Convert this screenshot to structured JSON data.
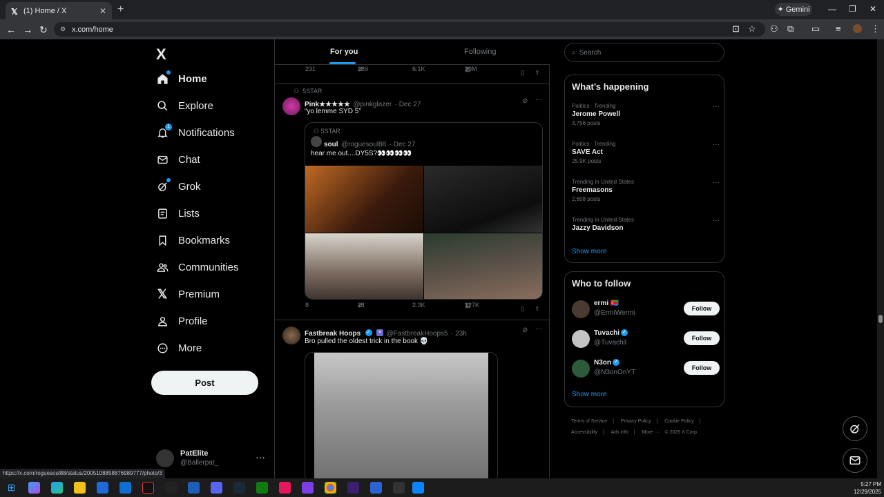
{
  "browser": {
    "tab_title": "(1) Home / X",
    "new_tab": "+",
    "gemini_label": "Gemini",
    "url": "x.com/home",
    "status_url": "https://x.com/roguesoul88/status/2005108858876989777/photo/3"
  },
  "nav": {
    "logo": "X",
    "items": [
      {
        "label": "Home",
        "icon": "home-icon"
      },
      {
        "label": "Explore",
        "icon": "search-icon"
      },
      {
        "label": "Notifications",
        "icon": "bell-icon",
        "badge": "1"
      },
      {
        "label": "Chat",
        "icon": "mail-icon"
      },
      {
        "label": "Grok",
        "icon": "grok-icon"
      },
      {
        "label": "Lists",
        "icon": "list-icon"
      },
      {
        "label": "Bookmarks",
        "icon": "bookmark-icon"
      },
      {
        "label": "Communities",
        "icon": "people-icon"
      },
      {
        "label": "Premium",
        "icon": "x-icon"
      },
      {
        "label": "Profile",
        "icon": "person-icon"
      },
      {
        "label": "More",
        "icon": "more-circle-icon"
      }
    ],
    "post_label": "Post",
    "account": {
      "name": "PatElite",
      "handle": "@Ballerpat_",
      "more": "···"
    }
  },
  "main": {
    "tabs": [
      {
        "label": "For you"
      },
      {
        "label": "Following"
      }
    ],
    "prev_actions": {
      "replies": "231",
      "reposts": "389",
      "likes": "6.1K",
      "views": "20M"
    },
    "tweet1": {
      "context": "5STAR",
      "name": "Pink★★★★★",
      "handle": "@pinkglazer",
      "date": "· Dec 27",
      "text": "“yo lemme SYD 5”",
      "quote": {
        "context": "5STAR",
        "name": "soul",
        "handle": "@roguesoul88",
        "date": "· Dec 27",
        "text": "hear me out....DY5S?👀👀👀👀"
      },
      "actions": {
        "replies": "8",
        "reposts": "24",
        "likes": "2.3K",
        "views": "127K"
      }
    },
    "tweet2": {
      "name": "Fastbreak Hoops",
      "handle": "@FastbreakHoops5",
      "date": "· 23h",
      "text": "Bro pulled the oldest trick in the book 💀"
    }
  },
  "right": {
    "search_placeholder": "Search",
    "happening": {
      "title": "What’s happening",
      "trends": [
        {
          "category": "Politics · Trending",
          "name": "Jerome Powell",
          "count": "3,756 posts"
        },
        {
          "category": "Politics · Trending",
          "name": "SAVE Act",
          "count": "25.9K posts"
        },
        {
          "category": "Trending in United States",
          "name": "Freemasons",
          "count": "2,608 posts"
        },
        {
          "category": "Trending in United States",
          "name": "Jazzy Davidson",
          "count": ""
        }
      ],
      "show_more": "Show more"
    },
    "who_to_follow": {
      "title": "Who to follow",
      "accounts": [
        {
          "name": "ermi 🇪🇷",
          "handle": "@ErmiWermi",
          "button": "Follow"
        },
        {
          "name": "Tuvachi",
          "handle": "@Tuvachil",
          "button": "Follow"
        },
        {
          "name": "N3on",
          "handle": "@N3onOnYT",
          "button": "Follow"
        }
      ],
      "show_more": "Show more"
    },
    "footer": [
      "Terms of Service",
      "|",
      "Privacy Policy",
      "|",
      "Cookie Policy",
      "|",
      "Accessibility",
      "|",
      "Ads info",
      "|",
      "More ···",
      "© 2025 X Corp."
    ]
  },
  "taskbar": {
    "time": "5:27 PM",
    "date": "12/29/2025"
  },
  "colors": {
    "accent": "#1d9bf0",
    "bg": "#000000",
    "border": "#2f3336",
    "muted": "#71767b"
  }
}
